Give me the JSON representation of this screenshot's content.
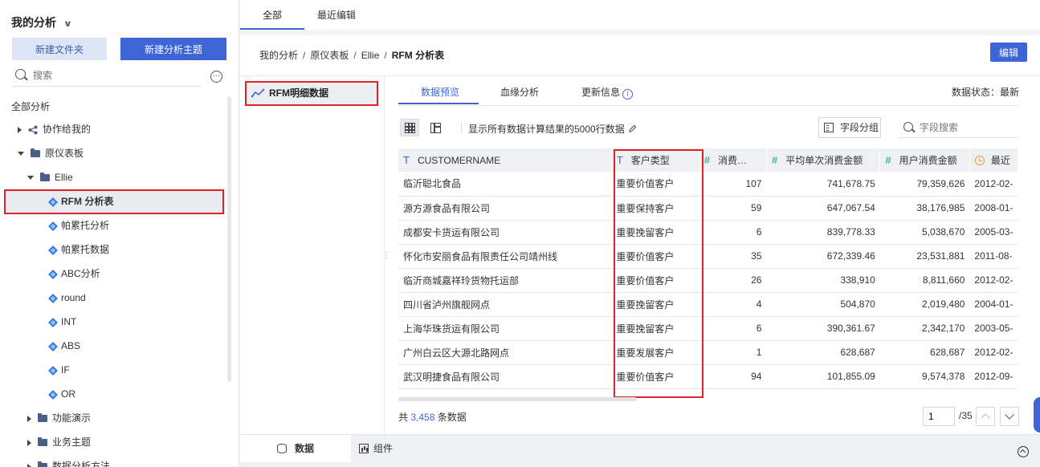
{
  "sidebar": {
    "title": "我的分析",
    "new_folder": "新建文件夹",
    "new_topic": "新建分析主题",
    "search_placeholder": "搜索",
    "more": "···",
    "root": "全部分析",
    "items": [
      {
        "label": "协作给我的"
      },
      {
        "label": "原仪表板"
      },
      {
        "label": "Ellie"
      },
      {
        "label": "RFM 分析表"
      },
      {
        "label": "帕累托分析"
      },
      {
        "label": "帕累托数据"
      },
      {
        "label": "ABC分析"
      },
      {
        "label": "round"
      },
      {
        "label": "INT"
      },
      {
        "label": "ABS"
      },
      {
        "label": "IF"
      },
      {
        "label": "OR"
      },
      {
        "label": "功能演示"
      },
      {
        "label": "业务主题"
      },
      {
        "label": "数据分析方法"
      }
    ]
  },
  "top_tabs": [
    "全部",
    "最近编辑"
  ],
  "breadcrumb": [
    "我的分析",
    "原仪表板",
    "Ellie",
    "RFM 分析表"
  ],
  "edit_button": "编辑",
  "dataset": {
    "label": "RFM明细数据"
  },
  "content_tabs": [
    "数据预览",
    "血缘分析",
    "更新信息"
  ],
  "data_status": "数据状态：最新",
  "toolbar": {
    "note": "显示所有数据计算结果的5000行数据",
    "group_button": "字段分组",
    "field_search_placeholder": "字段搜索"
  },
  "table": {
    "headers": [
      "CUSTOMERNAME",
      "客户类型",
      "消费…",
      "平均单次消费金额",
      "用户消费金额",
      "最近"
    ],
    "rows": [
      [
        "临沂聪北食品",
        "重要价值客户",
        "107",
        "741,678.75",
        "79,359,626",
        "2012-02-"
      ],
      [
        "源方源食品有限公司",
        "重要保持客户",
        "59",
        "647,067.54",
        "38,176,985",
        "2008-01-"
      ],
      [
        "成都安卡货运有限公司",
        "重要挽留客户",
        "6",
        "839,778.33",
        "5,038,670",
        "2005-03-"
      ],
      [
        "怀化市安丽食品有限责任公司靖州线",
        "重要价值客户",
        "35",
        "672,339.46",
        "23,531,881",
        "2011-08-"
      ],
      [
        "临沂商城嘉祥玲货物托运部",
        "重要价值客户",
        "26",
        "338,910",
        "8,811,660",
        "2012-02-"
      ],
      [
        "四川省泸州旗舰网点",
        "重要挽留客户",
        "4",
        "504,870",
        "2,019,480",
        "2004-01-"
      ],
      [
        "上海华珠货运有限公司",
        "重要挽留客户",
        "6",
        "390,361.67",
        "2,342,170",
        "2003-05-"
      ],
      [
        "广州白云区大源北路网点",
        "重要发展客户",
        "1",
        "628,687",
        "628,687",
        "2012-02-"
      ],
      [
        "武汉明捷食品有限公司",
        "重要价值客户",
        "94",
        "101,855.09",
        "9,574,378",
        "2012-09-"
      ]
    ]
  },
  "footer": {
    "prefix": "共",
    "count": "3,458",
    "suffix": "条数据",
    "page": "1",
    "total_pages": "/35"
  },
  "bottom_tabs": [
    "数据",
    "组件"
  ]
}
